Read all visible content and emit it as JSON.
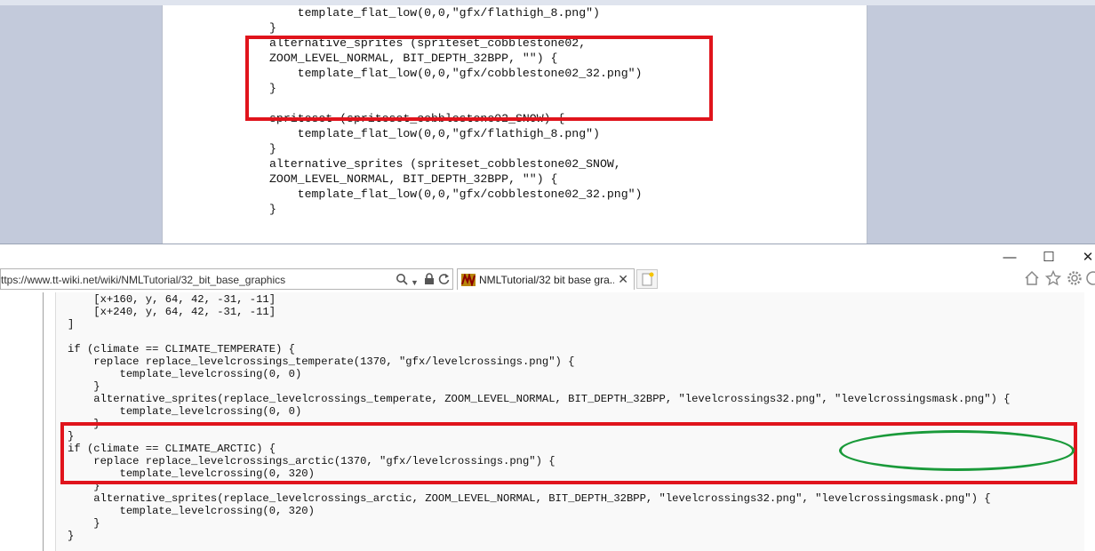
{
  "background_document": {
    "code_lines": [
      "    template_flat_low(0,0,\"gfx/flathigh_8.png\")",
      "}",
      "alternative_sprites (spriteset_cobblestone02,",
      "ZOOM_LEVEL_NORMAL, BIT_DEPTH_32BPP, \"\") {",
      "    template_flat_low(0,0,\"gfx/cobblestone02_32.png\")",
      "}",
      "",
      "spriteset (spriteset_cobblestone02_SNOW) {",
      "    template_flat_low(0,0,\"gfx/flathigh_8.png\")",
      "}",
      "alternative_sprites (spriteset_cobblestone02_SNOW,",
      "ZOOM_LEVEL_NORMAL, BIT_DEPTH_32BPP, \"\") {",
      "    template_flat_low(0,0,\"gfx/cobblestone02_32.png\")",
      "}"
    ],
    "highlight_color": "#e0141c"
  },
  "browser": {
    "window_controls": {
      "minimize": "—",
      "maximize": "☐",
      "close": "✕"
    },
    "address_bar": {
      "url": "ttps://www.tt-wiki.net/wiki/NMLTutorial/32_bit_base_graphics"
    },
    "tab": {
      "title": "NMLTutorial/32 bit base gra...",
      "close": "✕"
    },
    "toolbar_icons": [
      "home-icon",
      "favorites-icon",
      "settings-icon",
      "smiley-icon"
    ],
    "code_lines": [
      "    [x+160, y, 64, 42, -31, -11]",
      "    [x+240, y, 64, 42, -31, -11]",
      "]",
      "",
      "if (climate == CLIMATE_TEMPERATE) {",
      "    replace replace_levelcrossings_temperate(1370, \"gfx/levelcrossings.png\") {",
      "        template_levelcrossing(0, 0)",
      "    }",
      "    alternative_sprites(replace_levelcrossings_temperate, ZOOM_LEVEL_NORMAL, BIT_DEPTH_32BPP, \"levelcrossings32.png\", \"levelcrossingsmask.png\") {",
      "        template_levelcrossing(0, 0)",
      "    }",
      "}",
      "if (climate == CLIMATE_ARCTIC) {",
      "    replace replace_levelcrossings_arctic(1370, \"gfx/levelcrossings.png\") {",
      "        template_levelcrossing(0, 320)",
      "    }",
      "    alternative_sprites(replace_levelcrossings_arctic, ZOOM_LEVEL_NORMAL, BIT_DEPTH_32BPP, \"levelcrossings32.png\", \"levelcrossingsmask.png\") {",
      "        template_levelcrossing(0, 320)",
      "    }",
      "}"
    ],
    "highlight_color": "#e0141c",
    "ellipse_color": "#1a9a3a"
  }
}
